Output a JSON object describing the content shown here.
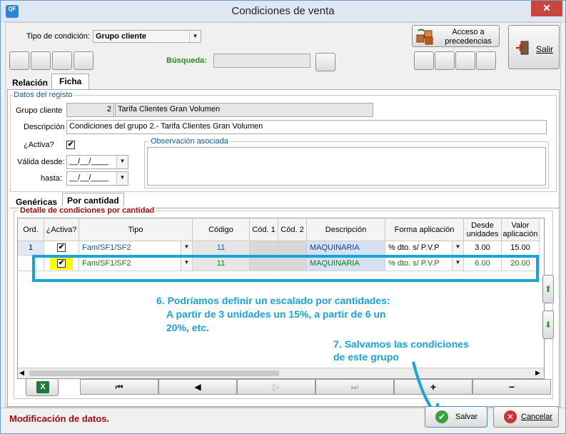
{
  "window": {
    "title": "Condiciones de venta",
    "app_icon_label": "QF"
  },
  "header": {
    "tipo_label": "Tipo de condición:",
    "tipo_value": "Grupo cliente",
    "acceso_label_1": "Acceso a",
    "acceso_label_2": "precedencias",
    "salir_label": "Salir",
    "busqueda_label": "Búsqueda:"
  },
  "tabs": {
    "relacion": "Relación",
    "ficha": "Ficha"
  },
  "ficha": {
    "section_title": "Datos del registo",
    "grupo_label": "Grupo cliente",
    "grupo_code": "2",
    "grupo_name": "Tarifa Clientes Gran Volumen",
    "descripcion_label": "Descripción",
    "descripcion_value": "Condiciones del grupo 2.- Tarifa Clientes Gran Volumen",
    "activa_label": "¿Activa?",
    "activa_checked": "✔",
    "valida_label": "Válida desde:",
    "hasta_label": "hasta:",
    "date_placeholder": "__/__/____",
    "observacion_label": "Observación asociada"
  },
  "subtabs": {
    "genericas": "Genéricas",
    "por_cantidad": "Por cantidad"
  },
  "detalle": {
    "title": "Detalle de condiciones por cantidad",
    "columns": [
      "Ord.",
      "¿Activa?",
      "Tipo",
      "Código",
      "Cód. 1",
      "Cód. 2",
      "Descripción",
      "Forma aplicación",
      "Desde unidades",
      "Valor aplicación"
    ],
    "rows": [
      {
        "ord": "1",
        "activa": "✔",
        "tipo": "Fam/SF1/SF2",
        "codigo": "11",
        "cod1": "",
        "cod2": "",
        "descripcion": "MAQUINARIA",
        "forma": "% dto. s/ P.V.P",
        "desde": "3.00",
        "valor": "15.00"
      },
      {
        "ord": "",
        "activa": "✔",
        "tipo": "Fam/SF1/SF2",
        "codigo": "11",
        "cod1": "",
        "cod2": "",
        "descripcion": "MAQUINARIA",
        "forma": "% dto. s/ P.V.P",
        "desde": "6.00",
        "valor": "20.00"
      }
    ]
  },
  "nav": {
    "first": "⏮",
    "prev": "◀",
    "next": "▷",
    "last": "⏭",
    "add": "+",
    "remove": "−"
  },
  "annotations": {
    "a6_line1": "6. Podríamos definir un escalado por cantidades:",
    "a6_line2": "A partir de 3 unidades un 15%, a partir de 6 un",
    "a6_line3": "20%, etc.",
    "a7_line1": "7. Salvamos las condiciones",
    "a7_line2": "de este grupo"
  },
  "status": {
    "text": "Modificación de datos."
  },
  "footer": {
    "salvar": "Salvar",
    "cancelar": "Cancelar"
  },
  "colors": {
    "accent": "#1aa3d8",
    "status_text": "#a01010",
    "busqueda": "#2a8a2a",
    "row_green": "#1a7a1a"
  }
}
